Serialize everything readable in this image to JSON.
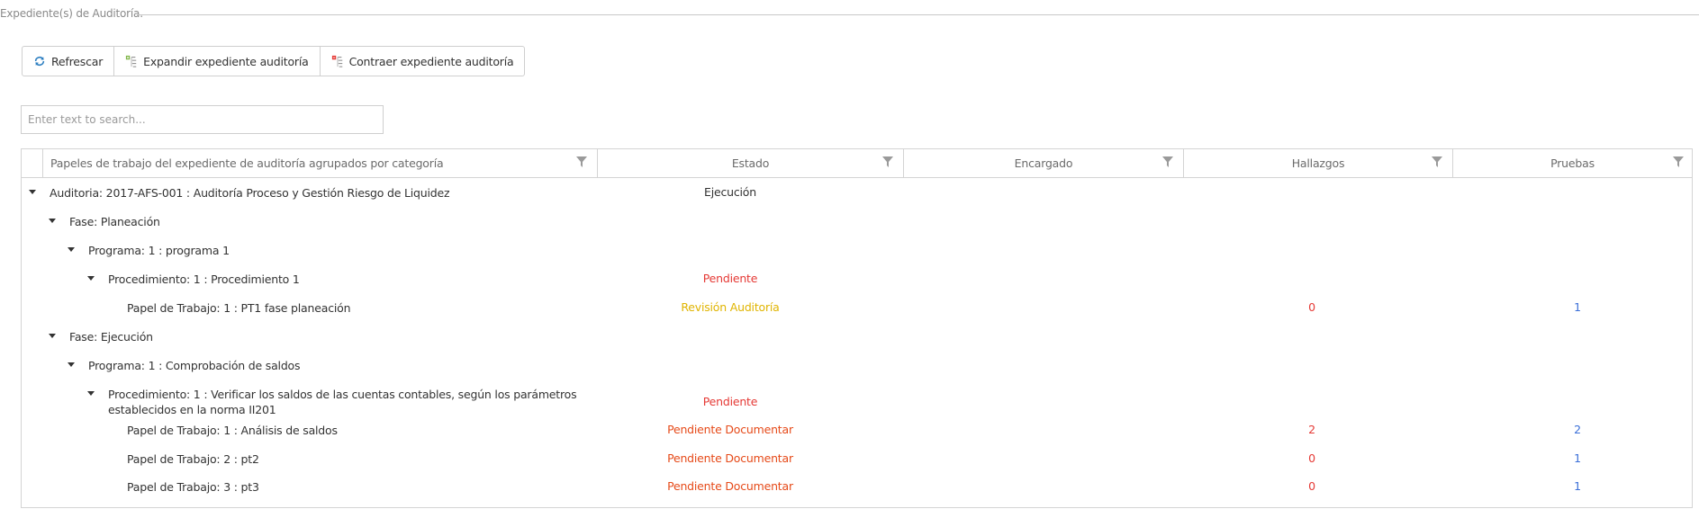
{
  "legend": "Expediente(s) de Auditoría.",
  "toolbar": {
    "refresh_label": "Refrescar",
    "expand_label": "Expandir expediente auditoría",
    "collapse_label": "Contraer expediente auditoría"
  },
  "search": {
    "placeholder": "Enter text to search..."
  },
  "columns": {
    "papeles": "Papeles de trabajo del expediente de auditoría agrupados por categoría",
    "estado": "Estado",
    "encargado": "Encargado",
    "hallazgos": "Hallazgos",
    "pruebas": "Pruebas"
  },
  "colors": {
    "estado_ejecucion": "#333333",
    "estado_pendiente": "#e53935",
    "estado_revision": "#e0b400",
    "estado_pendiente_documentar": "#e64a19",
    "hallazgos": "#e53935",
    "pruebas": "#3b6fd8"
  },
  "rows": [
    {
      "label": "Auditoria: 2017-AFS-001 : Auditoría Proceso y Gestión Riesgo de Liquidez",
      "estado": "Ejecución",
      "hallazgos": "",
      "pruebas": ""
    },
    {
      "label": "Fase: Planeación",
      "estado": "",
      "hallazgos": "",
      "pruebas": ""
    },
    {
      "label": "Programa: 1 : programa 1",
      "estado": "",
      "hallazgos": "",
      "pruebas": ""
    },
    {
      "label": "Procedimiento: 1 :  Procedimiento 1",
      "estado": "Pendiente",
      "hallazgos": "",
      "pruebas": ""
    },
    {
      "label": "Papel de Trabajo: 1 : PT1 fase planeación",
      "estado": "Revisión Auditoría",
      "hallazgos": "0",
      "pruebas": "1"
    },
    {
      "label": "Fase: Ejecución",
      "estado": "",
      "hallazgos": "",
      "pruebas": ""
    },
    {
      "label": "Programa: 1 : Comprobación de saldos",
      "estado": "",
      "hallazgos": "",
      "pruebas": ""
    },
    {
      "label_line1": "Procedimiento: 1 :  Verificar los saldos de las cuentas contables, según los parámetros",
      "label_line2": "establecidos en la norma II201",
      "estado": "Pendiente",
      "hallazgos": "",
      "pruebas": ""
    },
    {
      "label": "Papel de Trabajo: 1 : Análisis de saldos",
      "estado": "Pendiente Documentar",
      "hallazgos": "2",
      "pruebas": "2"
    },
    {
      "label": "Papel de Trabajo: 2 : pt2",
      "estado": "Pendiente Documentar",
      "hallazgos": "0",
      "pruebas": "1"
    },
    {
      "label": "Papel de Trabajo: 3 : pt3",
      "estado": "Pendiente Documentar",
      "hallazgos": "0",
      "pruebas": "1"
    }
  ]
}
